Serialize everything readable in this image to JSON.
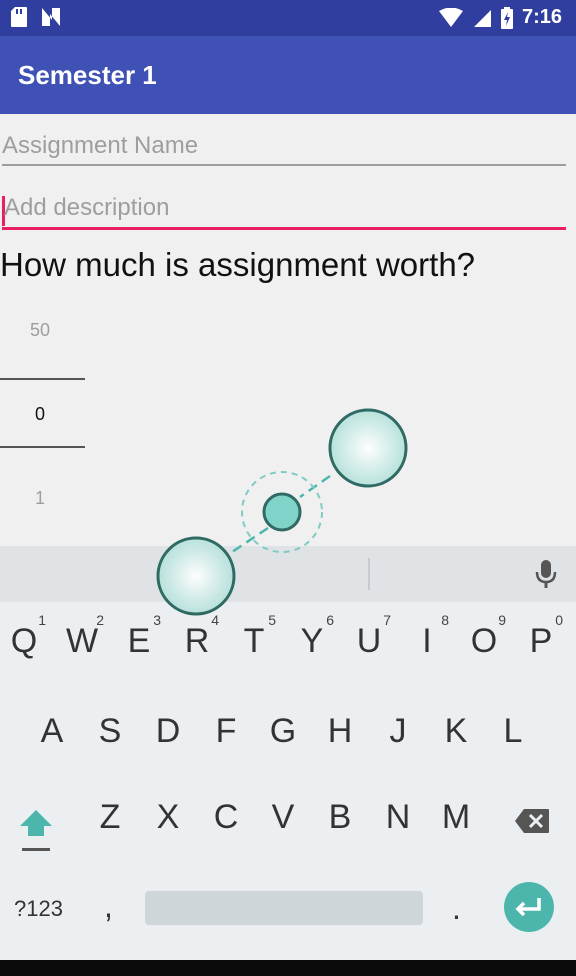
{
  "status_bar": {
    "time": "7:16"
  },
  "app_bar": {
    "title": "Semester 1"
  },
  "form": {
    "assignment_name_placeholder": "Assignment Name",
    "description_placeholder": "Add description",
    "question": "How much is assignment worth?"
  },
  "number_picker": {
    "previous": "50",
    "current": "0",
    "next": "1"
  },
  "keyboard": {
    "row1": [
      {
        "label": "Q",
        "num": "1"
      },
      {
        "label": "W",
        "num": "2"
      },
      {
        "label": "E",
        "num": "3"
      },
      {
        "label": "R",
        "num": "4"
      },
      {
        "label": "T",
        "num": "5"
      },
      {
        "label": "Y",
        "num": "6"
      },
      {
        "label": "U",
        "num": "7"
      },
      {
        "label": "I",
        "num": "8"
      },
      {
        "label": "O",
        "num": "9"
      },
      {
        "label": "P",
        "num": "0"
      }
    ],
    "row2": [
      "A",
      "S",
      "D",
      "F",
      "G",
      "H",
      "J",
      "K",
      "L"
    ],
    "row3": [
      "Z",
      "X",
      "C",
      "V",
      "B",
      "N",
      "M"
    ],
    "symbols_label": "?123",
    "comma_label": ",",
    "period_label": ".",
    "colors": {
      "accent": "#4db6ac",
      "key_text": "#333333",
      "background": "#eceff1"
    }
  },
  "colors": {
    "primary": "#3f51b5",
    "primary_dark": "#303f9f",
    "focus_underline": "#e91e63"
  }
}
